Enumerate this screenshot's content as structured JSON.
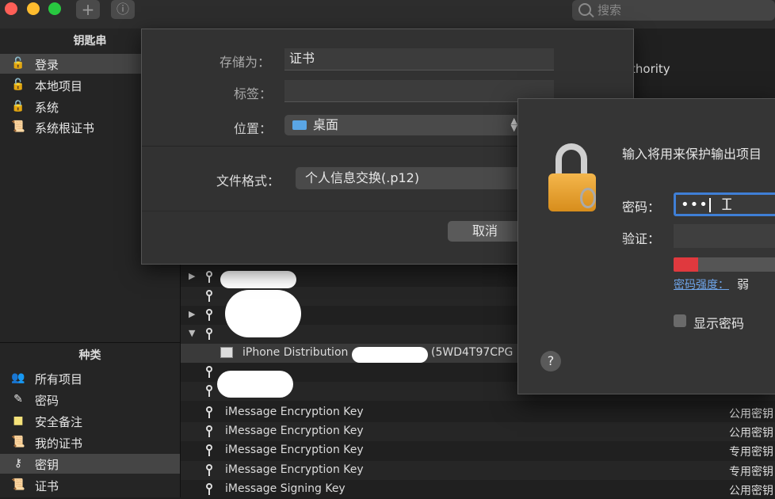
{
  "toolbar": {
    "add_icon": "plus-icon",
    "info_icon": "info-icon",
    "search_placeholder": "搜索"
  },
  "sidebar": {
    "keychains_header": "钥匙串",
    "keychains": [
      {
        "label": "登录",
        "icon": "lock-open-icon"
      },
      {
        "label": "本地项目",
        "icon": "lock-open-icon"
      },
      {
        "label": "系统",
        "icon": "lock-icon"
      },
      {
        "label": "系统根证书",
        "icon": "certificate-icon"
      }
    ],
    "category_header": "种类",
    "categories": [
      {
        "label": "所有项目",
        "icon": "people-icon"
      },
      {
        "label": "密码",
        "icon": "pen-icon"
      },
      {
        "label": "安全备注",
        "icon": "note-icon"
      },
      {
        "label": "我的证书",
        "icon": "certificate-icon"
      },
      {
        "label": "密钥",
        "icon": "key-icon"
      },
      {
        "label": "证书",
        "icon": "certificate-icon"
      }
    ]
  },
  "list": {
    "partial_text": "thority",
    "selected_row": "iPhone Distribution",
    "selected_row_suffix": "(5WD4T97CPG",
    "rows": [
      {
        "name": "iMessage Encryption Key",
        "kind": "公用密钥"
      },
      {
        "name": "iMessage Encryption Key",
        "kind": "公用密钥"
      },
      {
        "name": "iMessage Encryption Key",
        "kind": "专用密钥"
      },
      {
        "name": "iMessage Encryption Key",
        "kind": "专用密钥"
      },
      {
        "name": "iMessage Signing Key",
        "kind": "公用密钥"
      }
    ]
  },
  "export_sheet": {
    "save_as_label": "存储为：",
    "save_as_value": "证书",
    "tags_label": "标签：",
    "location_label": "位置：",
    "location_value": "桌面",
    "format_label": "文件格式：",
    "format_value": "个人信息交换(.p12)",
    "cancel_label": "取消"
  },
  "password_dialog": {
    "message": "输入将用来保护输出项目",
    "password_label": "密码：",
    "password_value": "•••",
    "verify_label": "验证：",
    "strength_label": "密码强度：",
    "strength_value": "弱",
    "strength_level": 0.22,
    "show_password_label": "显示密码",
    "help_label": "?"
  },
  "colors": {
    "accent": "#3f7fd6",
    "strength_weak": "#e0393e",
    "lock_gold": "#f4b64c"
  }
}
